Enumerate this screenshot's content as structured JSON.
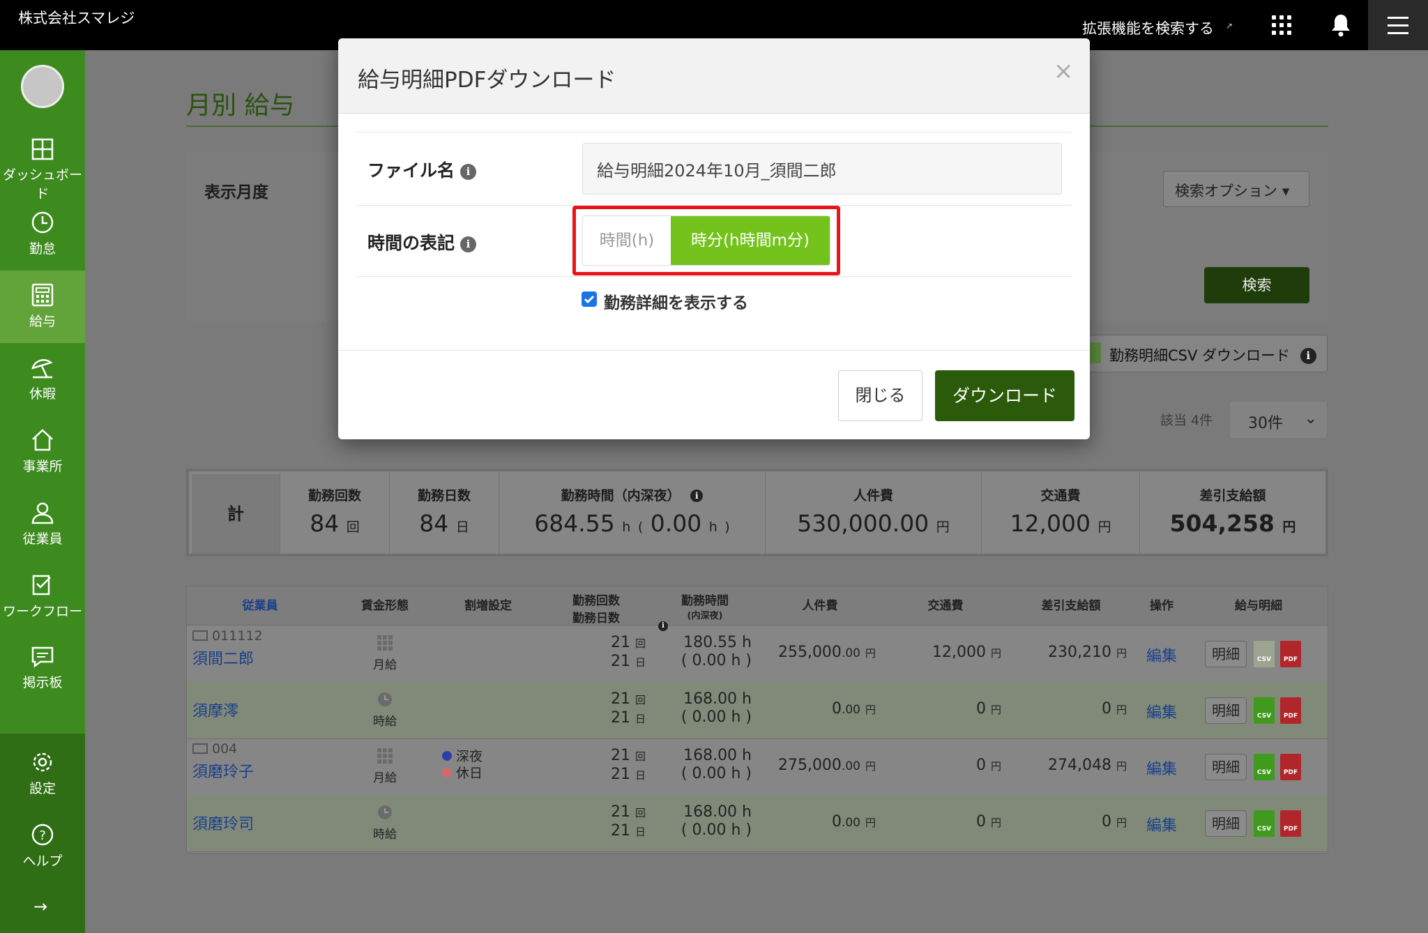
{
  "header": {
    "company": "株式会社スマレジ",
    "extensions_link": "拡張機能を検索する"
  },
  "sidebar": {
    "items": [
      {
        "label": "ダッシュボード",
        "icon": "dashboard-icon"
      },
      {
        "label": "勤怠",
        "icon": "clock-icon"
      },
      {
        "label": "給与",
        "icon": "calculator-icon",
        "active": true
      },
      {
        "label": "休暇",
        "icon": "parasol-icon"
      },
      {
        "label": "事業所",
        "icon": "home-icon"
      },
      {
        "label": "従業員",
        "icon": "person-icon"
      },
      {
        "label": "ワークフロー",
        "icon": "checklist-icon"
      },
      {
        "label": "掲示板",
        "icon": "chat-icon"
      }
    ],
    "bottom": [
      {
        "label": "設定",
        "icon": "gear-icon"
      },
      {
        "label": "ヘルプ",
        "icon": "help-icon"
      }
    ],
    "collapse_icon": "arrow-right-icon"
  },
  "page": {
    "title": "月別 給与",
    "search_label": "表示月度",
    "search_options": "検索オプション",
    "search_button": "検索",
    "csv_download": "勤務明細CSV ダウンロード",
    "count": "該当 4件",
    "per_page": "30件"
  },
  "summary": {
    "label": "計",
    "cols": [
      {
        "h": "勤務回数",
        "v": "84",
        "u": "回"
      },
      {
        "h": "勤務日数",
        "v": "84",
        "u": "日"
      },
      {
        "h": "勤務時間（内深夜）",
        "v": "684.55",
        "u": "h",
        "v2": "0.00",
        "u2": "h"
      },
      {
        "h": "人件費",
        "v": "530,000.00",
        "u": "円"
      },
      {
        "h": "交通費",
        "v": "12,000",
        "u": "円"
      },
      {
        "h": "差引支給額",
        "v": "504,258",
        "u": "円"
      }
    ]
  },
  "table": {
    "headers": {
      "employee": "従業員",
      "wage": "賃金形態",
      "premium": "割増設定",
      "count1": "勤務回数",
      "count2": "勤務日数",
      "hours1": "勤務時間",
      "hours2": "(内深夜)",
      "cost": "人件費",
      "transport": "交通費",
      "net": "差引支給額",
      "ops": "操作",
      "slip": "給与明細"
    },
    "rows": [
      {
        "code": "011112",
        "name": "須間二郎",
        "wage": "月給",
        "premium": [],
        "times": "21",
        "days": "21",
        "hours": "180.55 h",
        "night": "( 0.00 h )",
        "cost": "255,000",
        "cost_dec": ".00",
        "transport": "12,000",
        "net": "230,210",
        "edit": "編集",
        "detail": "明細",
        "csv_active": false
      },
      {
        "code": "",
        "name": "須摩澪",
        "wage": "時給",
        "premium": [],
        "times": "21",
        "days": "21",
        "hours": "168.00 h",
        "night": "( 0.00 h )",
        "cost": "0",
        "cost_dec": ".00",
        "transport": "0",
        "net": "0",
        "edit": "編集",
        "detail": "明細",
        "csv_active": true
      },
      {
        "code": "004",
        "name": "須磨玲子",
        "wage": "月給",
        "premium": [
          "深夜",
          "休日"
        ],
        "times": "21",
        "days": "21",
        "hours": "168.00 h",
        "night": "( 0.00 h )",
        "cost": "275,000",
        "cost_dec": ".00",
        "transport": "0",
        "net": "274,048",
        "edit": "編集",
        "detail": "明細",
        "csv_active": true
      },
      {
        "code": "",
        "name": "須磨玲司",
        "wage": "時給",
        "premium": [],
        "times": "21",
        "days": "21",
        "hours": "168.00 h",
        "night": "( 0.00 h )",
        "cost": "0",
        "cost_dec": ".00",
        "transport": "0",
        "net": "0",
        "edit": "編集",
        "detail": "明細",
        "csv_active": true
      }
    ],
    "units": {
      "times": "回",
      "days": "日",
      "yen": "円"
    },
    "file_labels": {
      "csv": "CSV",
      "pdf": "PDF"
    }
  },
  "modal": {
    "title": "給与明細PDFダウンロード",
    "close_glyph": "×",
    "file_name_label": "ファイル名",
    "file_name_value": "給与明細2024年10月_須間二郎",
    "time_format_label": "時間の表記",
    "time_option_hours": "時間(h)",
    "time_option_hm": "時分(h時間m分)",
    "time_selected": "時分(h時間m分)",
    "show_details_label": "勤務詳細を表示する",
    "show_details_checked": true,
    "close_button": "閉じる",
    "download_button": "ダウンロード",
    "info_glyph": "i"
  },
  "colors": {
    "brand_green": "#62a33a",
    "selected_toggle": "#73c31c",
    "primary_button": "#2a5a0a",
    "highlight": "#e8161a"
  }
}
